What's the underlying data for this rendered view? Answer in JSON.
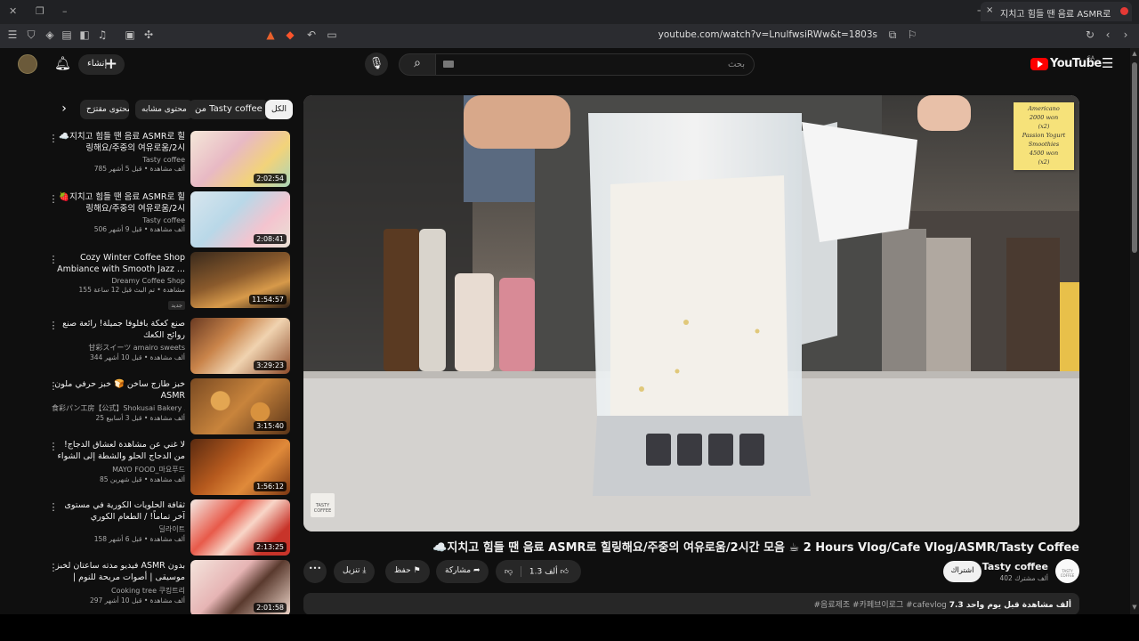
{
  "browser": {
    "tab_title": "지치고 힘들 땐 음료 ASMR로",
    "url": "youtube.com/watch?v=LnulfwsiRWw&t=1803s",
    "new_tab": "+",
    "close": "×"
  },
  "yt": {
    "logo": "YouTube",
    "country": "SA",
    "create": "إنشاء",
    "search_placeholder": "بحث"
  },
  "chips": [
    "الكل",
    "من Tasty coffee",
    "محتوى مشابه",
    "محتوى مقترَح"
  ],
  "videos": [
    {
      "title": "☁️지치고 힘들 땐 음료 ASMR로 힐링해요/주중의 여유로움/2시",
      "channel": "Tasty coffee",
      "meta": "785 ألف مشاهدة • قبل 5 أشهر",
      "duration": "2:02:54"
    },
    {
      "title": "🍓지치고 힘들 땐 음료 ASMR로 힐링해요/주중의 여유로움/2시",
      "channel": "Tasty coffee",
      "meta": "506 ألف مشاهدة • قبل 9 أشهر",
      "duration": "2:08:41"
    },
    {
      "title": "Cozy Winter Coffee Shop Ambiance with Smooth Jazz ...",
      "channel": "Dreamy Coffee Shop",
      "meta": "155 مشاهدة • تم البث قبل 12 ساعة",
      "badge": "جديد",
      "duration": "11:54:57"
    },
    {
      "title": "صنع كعكة بافلوفا جميلة! رائعة صنع روائح الكعك",
      "channel": "甘彩スイーツ amairo sweets",
      "meta": "344 ألف مشاهدة • قبل 10 أشهر",
      "duration": "3:29:23"
    },
    {
      "title": "خبز طازج ساخن 🍞 خبز حرفي ملون ASMR",
      "channel": "食彩パン工房【公式】Shokusai Bakery ...",
      "meta": "25 ألف مشاهدة • قبل 3 أسابيع",
      "duration": "3:15:40"
    },
    {
      "title": "لا غني عن مشاهدة لعشاق الدجاج! من الدجاج الحلو والشطة إلى الشواء على الفحم",
      "channel": "MAYO FOOD_마요푸드",
      "meta": "85 ألف مشاهدة • قبل شهرين",
      "duration": "1:56:12"
    },
    {
      "title": "ثقافة الحلويات الكورية في مستوى آخر تماماً! / الطعام الكوري",
      "channel": "딜라이트",
      "meta": "158 ألف مشاهدة • قبل 6 أشهر",
      "duration": "2:13:25"
    },
    {
      "title": "فيديو مدته ساعتان لخبز ASMR بدون موسيقى | أصوات مريحة للنوم | كعكة، كعكة الجبن...",
      "channel": "Cooking tree 쿠킹트리",
      "meta": "297 ألف مشاهدة • قبل 10 أشهر",
      "duration": "2:01:58"
    }
  ],
  "player": {
    "note": [
      "Americano",
      "2000 won",
      "(x2)",
      "Passion Yogurt",
      "Smoothies",
      "4500 won",
      "(x2)"
    ],
    "watermark": "TASTY COFFEE"
  },
  "video": {
    "title": "☁️지치고 힘들 땐 음료 ASMR로 힐링해요/주중의 여유로움/2시간 모음 ☕ 2 Hours Vlog/Cafe Vlog/ASMR/Tasty Coffee",
    "channel": "Tasty coffee",
    "subs": "402 ألف مشترك",
    "subscribe": "اشتراك",
    "likes": "1.3 ألف",
    "share": "مشاركة",
    "save": "حفظ",
    "download": "تنزيل",
    "more": "•••",
    "desc_views": "7.3 ألف مشاهدة قبل يوم واحد",
    "desc_tags": "#음료제조 #카페브이로그 #cafevlog"
  },
  "colors": {
    "bg": "#0f0f0f",
    "accent": "#ff0000",
    "chip": "#272727"
  }
}
